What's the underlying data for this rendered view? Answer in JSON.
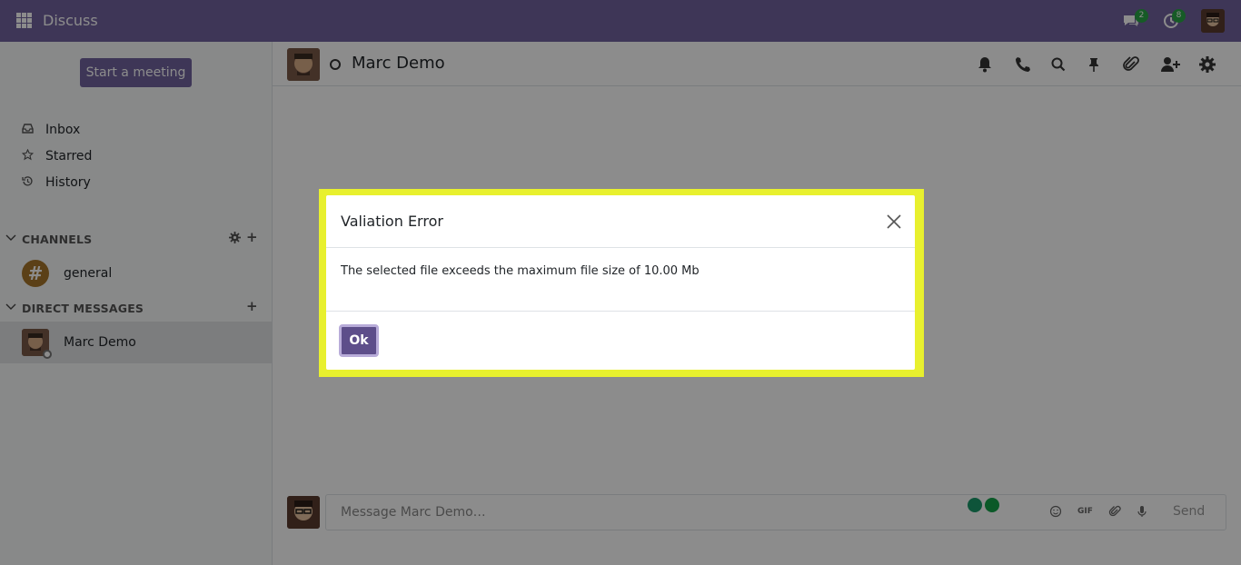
{
  "topbar": {
    "app_title": "Discuss",
    "messages_badge": "2",
    "activity_badge": "8",
    "accent": "#71639e"
  },
  "sidebar": {
    "meeting_button": "Start a meeting",
    "nav": [
      {
        "label": "Inbox",
        "icon": "inbox-icon"
      },
      {
        "label": "Starred",
        "icon": "star-icon"
      },
      {
        "label": "History",
        "icon": "history-icon"
      }
    ],
    "channels_header": "CHANNELS",
    "channels": [
      {
        "name": "general",
        "glyph": "#"
      }
    ],
    "dm_header": "DIRECT MESSAGES",
    "direct_messages": [
      {
        "name": "Marc Demo"
      }
    ]
  },
  "thread": {
    "name": "Marc Demo",
    "composer_placeholder": "Message Marc Demo…",
    "gif_label": "GIF",
    "send_label": "Send"
  },
  "dialog": {
    "title": "Valiation Error",
    "message": "The selected file exceeds the maximum file size of 10.00 Mb",
    "ok_label": "Ok",
    "highlight_color": "#e8f02e"
  }
}
